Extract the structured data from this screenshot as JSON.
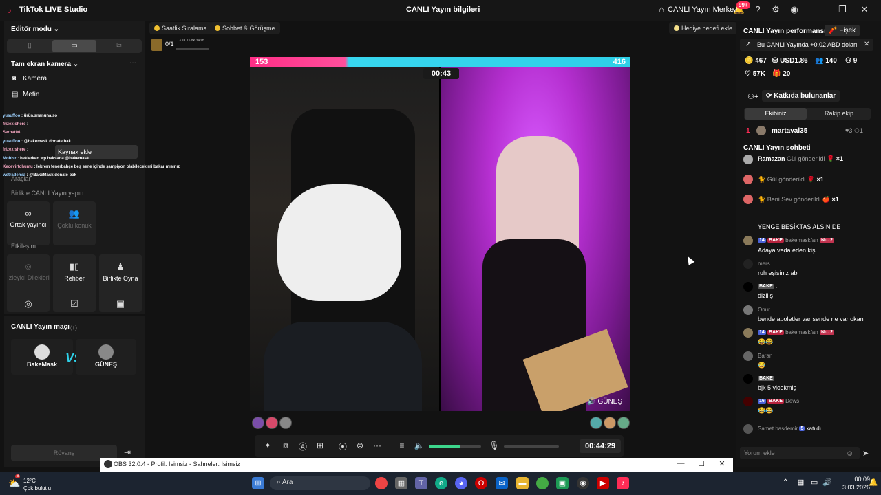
{
  "titlebar": {
    "app_title": "TikTok LIVE Studio",
    "center_title": "CANLI Yayın bilgileri",
    "live_center": "CANLI Yayın Merkezi",
    "notif_count": "99+"
  },
  "left": {
    "editor_mode": "Editör modu",
    "fullscreen_camera": "Tam ekran kamera",
    "sources": [
      "Kamera",
      "Metin"
    ],
    "add_source": "Kaynak ekle",
    "tools_hidden": "Araçlar",
    "collab_title": "Birlikte CANLI Yayın yapın",
    "collab_tiles": [
      "Ortak yayıncı",
      "Çoklu konuk"
    ],
    "interaction_title": "Etkileşim",
    "interaction_tiles": [
      "İzleyici Dilekleri",
      "Rehber",
      "Birlikte Oyna"
    ],
    "match_title": "CANLI Yayın maçı",
    "match_left": "BakeMask",
    "match_vs": "VS",
    "match_right": "GÜNEŞ",
    "rematch": "Rövanş"
  },
  "overlay_chat": [
    {
      "name": "yusuffoo",
      "msg": "ürün.snanuna.so"
    },
    {
      "name": "frizexishere",
      "msg": ""
    },
    {
      "name": "Serhat06",
      "msg": ""
    },
    {
      "name": "yusuffoo",
      "msg": "@bakemask donate bak"
    },
    {
      "name": "frizexishere",
      "msg": ""
    },
    {
      "name": "Mobisr",
      "msg": "beklerken wp baksana @bakemask"
    },
    {
      "name": "Kecevirtohumu",
      "msg": "lekrem fenerbahçe beş sene içinde şampiyon olabilecek mi bakar mısınız"
    },
    {
      "name": "wetrademia",
      "msg": "@BakeMask donate bak"
    }
  ],
  "center": {
    "hourly_rank": "Saatlik Sıralama",
    "chat_meet": "Sohbet & Görüşme",
    "gift_goal": "Hediye hedefi ekle",
    "rank_progress": "0/1",
    "rank_timer": "3 sa 15 dk 34 sn",
    "score_left": "153",
    "score_right": "416",
    "battle_timer": "00:43",
    "right_streamer": "GÜNEŞ",
    "stream_time": "00:44:29"
  },
  "right": {
    "perf_title": "CANLI Yayın performansı",
    "firework": "Fişek",
    "earnings_note": "Bu CANLI Yayında +0.02 ABD doları",
    "stats": {
      "coins": "467",
      "usd": "USD1.86",
      "viewers": "140",
      "gifters": "9",
      "likes": "57K",
      "gifts": "20"
    },
    "contributors": "Katkıda bulunanlar",
    "tab_ours": "Ekibiniz",
    "tab_rival": "Rakip ekip",
    "top_rank": "1",
    "top_user": "martaval35",
    "top_hearts": "3",
    "top_count": "1",
    "chat_title": "CANLI Yayın sohbeti",
    "gifts": [
      {
        "user": "Ramazan",
        "text": "Gül gönderildi",
        "mult": "×1"
      },
      {
        "user": "",
        "text": "Gül gönderildi",
        "mult": "×1"
      },
      {
        "user": "",
        "text": "Beni Sev gönderildi",
        "mult": "×1"
      }
    ],
    "messages": [
      {
        "user": "",
        "badges": [],
        "text": "YENGE BEŞİKTAŞ ALSIN DE"
      },
      {
        "user": "bakemaskfan",
        "badges": [
          "14",
          "BAKE",
          "No. 2"
        ],
        "text": "Adaya veda eden kişi"
      },
      {
        "user": "mers",
        "badges": [],
        "text": "ruh eşisiniz abi"
      },
      {
        "user": ".",
        "badges": [
          "BAKE"
        ],
        "text": "diziliş"
      },
      {
        "user": "Onur",
        "badges": [],
        "text": "bende apoletler var sende ne var okan"
      },
      {
        "user": "bakemaskfan",
        "badges": [
          "14",
          "BAKE",
          "No. 2"
        ],
        "text": "😂😂"
      },
      {
        "user": "Baran",
        "badges": [],
        "text": "😂"
      },
      {
        "user": ".",
        "badges": [
          "BAKE"
        ],
        "text": "bjk 5 yicekmiş"
      },
      {
        "user": "Dews",
        "badges": [
          "16",
          "BAKE"
        ],
        "text": "😂😂"
      }
    ],
    "join_user": "Samet basdemir",
    "join_level": "5",
    "join_text": "katıldı",
    "comment_placeholder": "Yorum ekle"
  },
  "obs": {
    "title": "OBS 32.0.4 - Profil: İsimsiz - Sahneler: İsimsiz"
  },
  "taskbar": {
    "temp": "12°C",
    "weather": "Çok bulutlu",
    "search": "Ara",
    "time": "00:09",
    "date": "3.03.2026",
    "weather_badge": "6"
  }
}
